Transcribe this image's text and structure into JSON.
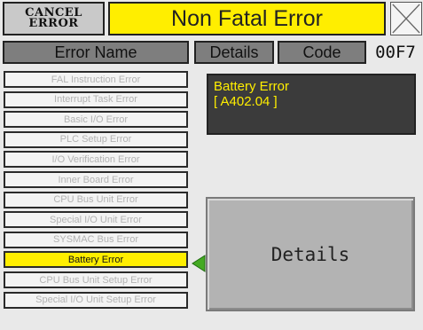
{
  "cancel_button": {
    "line1": "CANCEL",
    "line2": "ERROR"
  },
  "title": "Non Fatal Error",
  "close_icon": "close-x-icon",
  "headers": {
    "name": "Error Name",
    "details": "Details",
    "code": "Code",
    "code_value": "00F7"
  },
  "errors": [
    {
      "label": "FAL Instruction Error",
      "active": false
    },
    {
      "label": "Interrupt Task Error",
      "active": false
    },
    {
      "label": "Basic I/O Error",
      "active": false
    },
    {
      "label": "PLC Setup Error",
      "active": false
    },
    {
      "label": "I/O Verification Error",
      "active": false
    },
    {
      "label": "Inner Board Error",
      "active": false
    },
    {
      "label": "CPU Bus Unit Error",
      "active": false
    },
    {
      "label": "Special I/O Unit Error",
      "active": false
    },
    {
      "label": "SYSMAC Bus Error",
      "active": false
    },
    {
      "label": "Battery Error",
      "active": true
    },
    {
      "label": "CPU Bus Unit Setup Error",
      "active": false
    },
    {
      "label": "Special I/O Unit Setup Error",
      "active": false
    }
  ],
  "detail_display": {
    "line1": "Battery Error",
    "line2": "[ A402.04 ]"
  },
  "details_button": "Details",
  "colors": {
    "highlight": "#ffee00",
    "header": "#7e7e7e",
    "display_bg": "#3b3b3b",
    "arrow": "#44aa22"
  }
}
